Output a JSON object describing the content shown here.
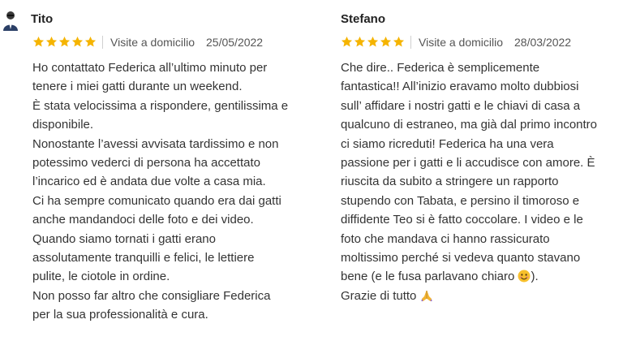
{
  "reviews": [
    {
      "author": "Tito",
      "rating": 5,
      "service": "Visite a domicilio",
      "date": "25/05/2022",
      "lines": [
        "Ho contattato Federica all’ultimo minuto per",
        "tenere i miei gatti durante un weekend.",
        "È stata velocissima a rispondere, gentilissima e",
        "disponibile.",
        "Nonostante l’avessi avvisata tardissimo e non",
        "potessimo vederci di persona ha accettato",
        "l’incarico ed è andata due volte a casa mia.",
        "Ci ha sempre comunicato quando era dai gatti",
        "anche mandandoci delle foto e dei video.",
        "Quando siamo tornati i gatti erano",
        "assolutamente tranquilli e felici, le lettiere",
        "pulite, le ciotole in ordine.",
        "Non posso far altro che consigliare Federica",
        "per la sua professionalità e cura."
      ]
    },
    {
      "author": "Stefano",
      "rating": 5,
      "service": "Visite a domicilio",
      "date": "28/03/2022",
      "lines": [
        "Che dire.. Federica è semplicemente",
        "fantastica!! All’inizio eravamo molto dubbiosi",
        "sull’ affidare i nostri gatti e le chiavi di casa a",
        "qualcuno di estraneo, ma già dal primo incontro",
        "ci siamo ricreduti!  Federica ha una vera",
        "passione per i gatti e li accudisce con amore. È",
        "riuscita da subito a stringere un rapporto",
        "stupendo con Tabata, e persino il timoroso e",
        "diffidente Teo si è fatto coccolare. I video e le",
        "foto che mandava ci hanno rassicurato",
        "moltissimo perché si vedeva quanto stavano",
        "bene (e le fusa parlavano chiaro",
        "Grazie di tutto"
      ],
      "line_12_suffix": ").",
      "smile_emoji": "smiling-face-emoji",
      "pray_emoji": "folded-hands-emoji"
    }
  ],
  "colors": {
    "star": "#f5b400",
    "text": "#333333",
    "meta": "#555555",
    "separator": "#d0d0d0"
  }
}
